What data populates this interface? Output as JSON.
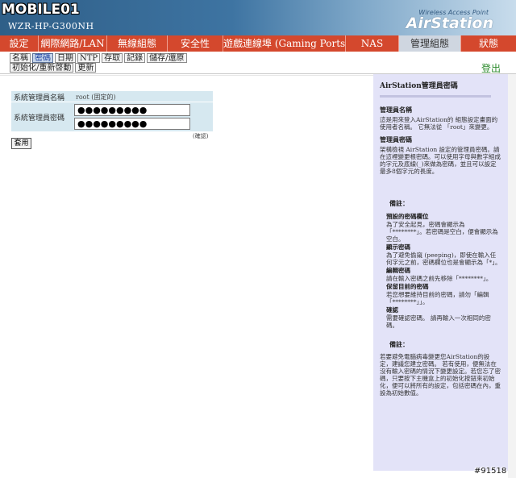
{
  "header": {
    "watermark": "MOBILE01",
    "watermark_sub": "",
    "model": "WZR-HP-G300NH",
    "brand_small": "Wireless Access Point",
    "brand_big": "AirStation"
  },
  "nav": {
    "items": [
      {
        "label": "設定"
      },
      {
        "label": "網際網路/LAN"
      },
      {
        "label": "無線組態"
      },
      {
        "label": "安全性"
      },
      {
        "label": "遊戲連線埠 (Gaming Ports)"
      },
      {
        "label": "NAS"
      },
      {
        "label": "管理組態"
      },
      {
        "label": "狀態"
      }
    ],
    "active_index": 6
  },
  "subnav": {
    "row1": [
      {
        "label": "名稱"
      },
      {
        "label": "密碼"
      },
      {
        "label": "日期"
      },
      {
        "label": "NTP"
      },
      {
        "label": "存取"
      },
      {
        "label": "記錄"
      },
      {
        "label": "儲存/還原"
      }
    ],
    "row2": [
      {
        "label": "初始化/重新啓動"
      },
      {
        "label": "更新"
      }
    ],
    "active": "密碼",
    "logout": "登出"
  },
  "form": {
    "admin_name_label": "系統管理員名稱",
    "admin_name_value": "root (固定的)",
    "admin_password_label": "系統管理員密碼",
    "password_value": "●●●●●●●●●",
    "confirm_value": "●●●●●●●●●",
    "confirm_label": "(確認)",
    "apply_label": "套用"
  },
  "help": {
    "title": "AirStation管理員密碼",
    "sections": [
      {
        "head": "管理員名稱",
        "text": "這是用來登入AirStation的 組態設定畫面的使用者名稱。 它無法從 「root」來變更。"
      },
      {
        "head": "管理員密碼",
        "text": "架構檢視 AirStation 設定的管理員密碼。請在這裡變更根密碼。可以使用字母與數字組成的字元及底線(_)來做為密碼，並且可以設定最多8個字元的長度。"
      }
    ],
    "note_head": "備註：",
    "notes": [
      {
        "head": "預設的密碼欄位",
        "text": "為了安全起見，密碼會顯示為「********」。若密碼是空白，便會顯示為空白。"
      },
      {
        "head": "顯示密碼",
        "text": "為了避免偷窺 (peeping)，即使在輸入任何字元之前，密碼欄位也是會顯示為「*」。"
      },
      {
        "head": "編輯密碼",
        "text": "請在輸入密碼之前先移除「********」。"
      },
      {
        "head": "保留目前的密碼",
        "text": "若您想要維持目前的密碼，請勿「編輯「********」」。"
      },
      {
        "head": "確認",
        "text": "需要確認密碼。 請再輸入一次相同的密碼。"
      }
    ],
    "note2_head": "備註：",
    "note2_text": "若要避免電腦病毒變更您AirStation的設定，建議您建立密碼。 若有使用，便無法在沒有輸入密碼的情況下變更設定。若您忘了密碼，只要按下主機盒上的初始化按鈕來初始化，便可以將所有的設定，包括密碼在內，重設為初始數值。"
  },
  "footer": {
    "id": "#91518"
  }
}
